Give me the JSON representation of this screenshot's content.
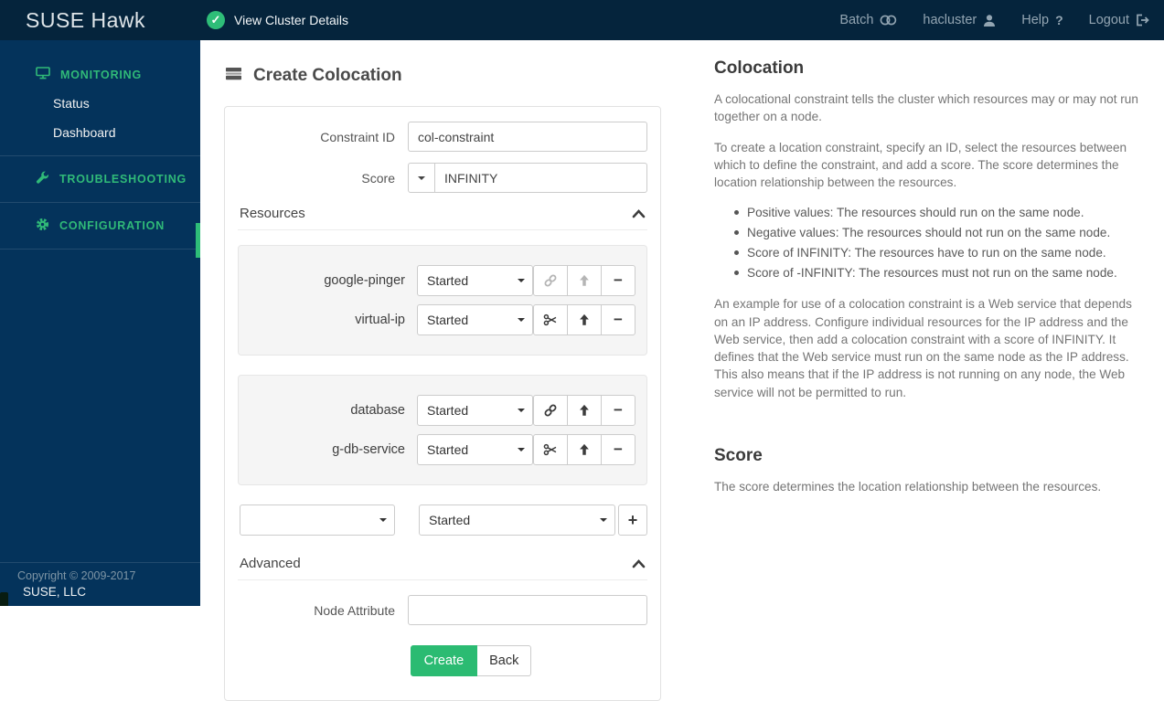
{
  "topbar": {
    "brand": "SUSE Hawk",
    "cluster_link": "View Cluster Details",
    "check_icon": "✓",
    "batch_label": "Batch",
    "username": "hacluster",
    "help_label": "Help",
    "help_icon": "?",
    "logout_label": "Logout"
  },
  "sidebar": {
    "monitoring": "MONITORING",
    "status": "Status",
    "dashboard": "Dashboard",
    "troubleshooting": "TROUBLESHOOTING",
    "configuration": "CONFIGURATION"
  },
  "footer": {
    "copyright": "Copyright © 2009-2017",
    "company": "SUSE, LLC"
  },
  "form": {
    "title": "Create Colocation",
    "constraint_id": {
      "label": "Constraint ID",
      "value": "col-constraint"
    },
    "score": {
      "label": "Score",
      "value": "INFINITY"
    },
    "resources_header": "Resources",
    "minus_icon": "−",
    "groups": [
      {
        "rows": [
          {
            "name": "google-pinger",
            "state": "Started"
          },
          {
            "name": "virtual-ip",
            "state": "Started"
          }
        ]
      },
      {
        "rows": [
          {
            "name": "database",
            "state": "Started"
          },
          {
            "name": "g-db-service",
            "state": "Started"
          }
        ]
      }
    ],
    "add_row": {
      "resource_value": "",
      "state": "Started",
      "plus_icon": "+"
    },
    "advanced_header": "Advanced",
    "node_attribute": {
      "label": "Node Attribute",
      "value": ""
    },
    "create_button": "Create",
    "back_button": "Back"
  },
  "help": {
    "colocation_title": "Colocation",
    "p1": "A colocational constraint tells the cluster which resources may or may not run together on a node.",
    "p2": "To create a location constraint, specify an ID, select the resources between which to define the constraint, and add a score. The score determines the location relationship between the resources.",
    "bullets": [
      "Positive values: The resources should run on the same node.",
      "Negative values: The resources should not run on the same node.",
      "Score of INFINITY: The resources have to run on the same node.",
      "Score of -INFINITY: The resources must not run on the same node."
    ],
    "p3": "An example for use of a colocation constraint is a Web service that depends on an IP address. Configure individual resources for the IP address and the Web service, then add a colocation constraint with a score of INFINITY. It defines that the Web service must run on the same node as the IP address. This also means that if the IP address is not running on any node, the Web service will not be permitted to run.",
    "score_title": "Score",
    "score_text": "The score determines the location relationship between the resources."
  },
  "colors": {
    "accent_green": "#30ba78",
    "topbar_bg": "#05243c",
    "sidebar_bg": "#04335b"
  }
}
